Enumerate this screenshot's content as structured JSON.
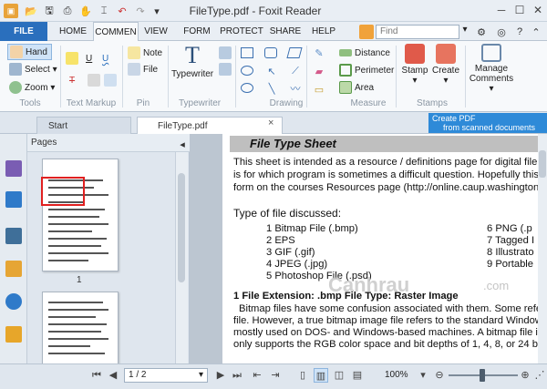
{
  "window": {
    "title": "FileType.pdf - Foxit Reader"
  },
  "ribbon_tabs": [
    "FILE",
    "HOME",
    "COMMEN",
    "VIEW",
    "FORM",
    "PROTECT",
    "SHARE",
    "HELP"
  ],
  "search": {
    "placeholder": "Find"
  },
  "tools": {
    "hand": "Hand",
    "select": "Select",
    "zoom": "Zoom",
    "group": "Tools"
  },
  "text_markup": {
    "u1": "U",
    "u2": "U",
    "t": "T",
    "group": "Text Markup"
  },
  "pin": {
    "note": "Note",
    "file": "File",
    "group": "Pin"
  },
  "typewriter": {
    "label": "Typewriter",
    "group": "Typewriter"
  },
  "drawing": {
    "group": "Drawing"
  },
  "measure": {
    "distance": "Distance",
    "perimeter": "Perimeter",
    "area": "Area",
    "group": "Measure"
  },
  "stamps": {
    "stamp": "Stamp",
    "create": "Create",
    "group": "Stamps"
  },
  "comments": {
    "manage": "Manage",
    "comments": "Comments"
  },
  "doc_tabs": {
    "start": "Start",
    "file": "FileType.pdf"
  },
  "promo": {
    "line1": "Create PDF",
    "line2": "from scanned documents"
  },
  "pages_panel": {
    "title": "Pages",
    "page1": "1"
  },
  "doc": {
    "title": "File Type Sheet",
    "intro1": "This sheet is intended as a resource / definitions page for digital file t",
    "intro2": "is for which program is sometimes a difficult question. Hopefully this s",
    "intro3": "form on the courses Resources page (http://online.caup.washington.e",
    "types_heading": "Type of file discussed:",
    "types_left": [
      "1 Bitmap File (.bmp)",
      "2 EPS",
      "3 GIF (.gif)",
      "4 JPEG (.jpg)",
      "5 Photoshop File (.psd)"
    ],
    "types_right": [
      "6 PNG (.p",
      "7 Tagged I",
      "8 Illustrato",
      "9 Portable"
    ],
    "section_heading": "1 File Extension: .bmp File Type: Raster Image",
    "body1": "Bitmap files have some confusion associated with them. Some refe",
    "body2": "file. However, a true bitmap image file refers to the standard Window",
    "body3": "mostly used on DOS- and Windows-based machines. A bitmap file is",
    "body4": "only supports the RGB color space and bit depths of 1, 4, 8, or 24 bit"
  },
  "watermark": {
    "text": "Canhrau",
    "suffix": ".com"
  },
  "status": {
    "page": "1 / 2",
    "zoom": "100%"
  }
}
